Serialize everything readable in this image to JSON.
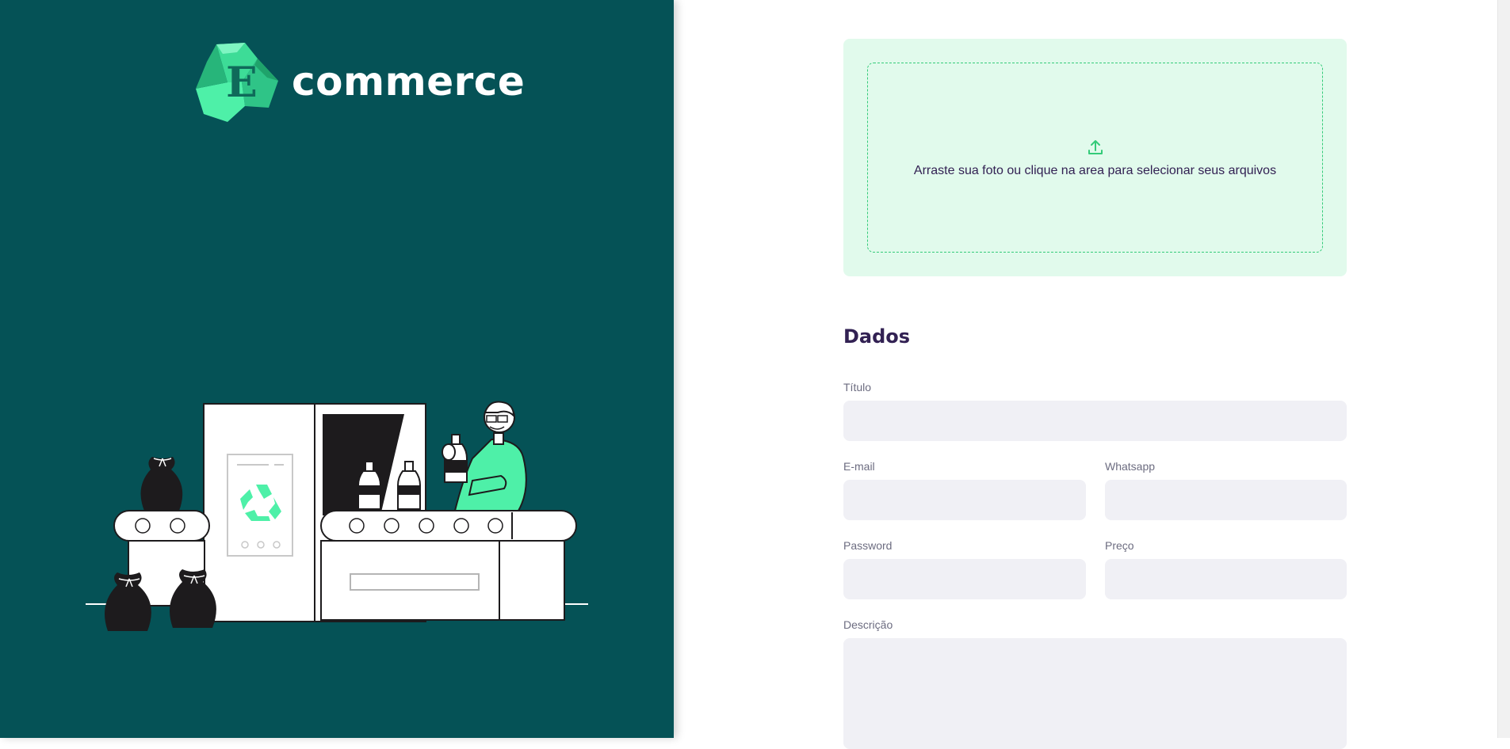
{
  "brand": {
    "logo_letter": "E",
    "name": "commerce"
  },
  "upload": {
    "text": "Arraste sua foto ou clique na area para selecionar seus arquivos",
    "icon": "upload-icon"
  },
  "form": {
    "section_title": "Dados",
    "fields": {
      "titulo": {
        "label": "Título",
        "value": ""
      },
      "email": {
        "label": "E-mail",
        "value": ""
      },
      "whatsapp": {
        "label": "Whatsapp",
        "value": ""
      },
      "password": {
        "label": "Password",
        "value": ""
      },
      "preco": {
        "label": "Preço",
        "value": ""
      },
      "descricao": {
        "label": "Descrição",
        "value": ""
      }
    }
  },
  "colors": {
    "panel_bg": "#055256",
    "accent_green": "#34cb79",
    "light_green": "#e1faec",
    "field_bg": "#f0f0f5",
    "title_purple": "#322153",
    "label_gray": "#6c6c80"
  }
}
